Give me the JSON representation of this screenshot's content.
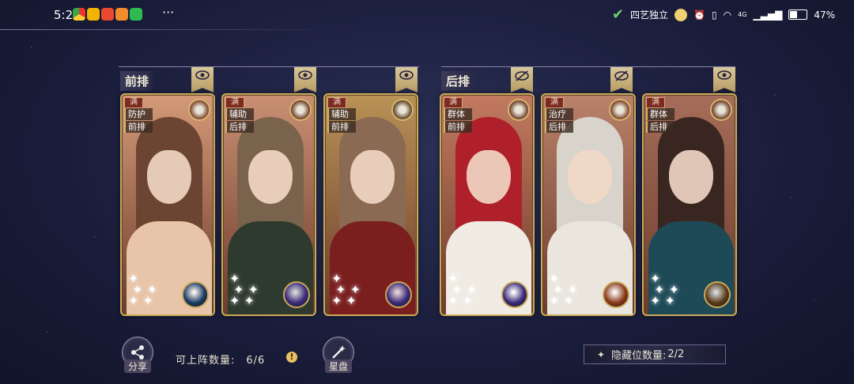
{
  "status_bar": {
    "time": "5:2",
    "more": "···",
    "mode_text": "四艺独立",
    "battery_percent": "47%",
    "network": "4G"
  },
  "sections": {
    "front_label": "前排",
    "back_label": "后排"
  },
  "cards": [
    {
      "mark": "满",
      "tags": [
        "防护",
        "前排"
      ],
      "element_icon": "white-fox-icon",
      "orb_icon": "blue-ring-orb-icon",
      "colors": {
        "bg": "#d49a78",
        "hair": "#6b4532",
        "body": "#e8c4a8",
        "elem": "#7a3f26",
        "orb": "#1b3a64"
      }
    },
    {
      "mark": "满",
      "tags": [
        "辅助",
        "后排"
      ],
      "element_icon": "white-bird-icon",
      "orb_icon": "purple-orb-icon",
      "colors": {
        "bg": "#c99073",
        "hair": "#7a634c",
        "body": "#2f3a2f",
        "elem": "#6b3a24",
        "orb": "#3a2a7a"
      }
    },
    {
      "mark": "满",
      "tags": [
        "辅助",
        "前排"
      ],
      "element_icon": "green-bird-icon",
      "orb_icon": "purple-orb-icon",
      "colors": {
        "bg": "#b89256",
        "hair": "#8a6a52",
        "body": "#7a1e1e",
        "elem": "#5a4020",
        "orb": "#3a2a7a"
      }
    },
    {
      "mark": "满",
      "tags": [
        "群体",
        "前排"
      ],
      "element_icon": "green-dragon-icon",
      "orb_icon": "purple-orb-icon",
      "colors": {
        "bg": "#c27a60",
        "hair": "#b0202a",
        "body": "#f0ece4",
        "elem": "#6b3a24",
        "orb": "#3a2a7a"
      }
    },
    {
      "mark": "满",
      "tags": [
        "治疗",
        "后排"
      ],
      "element_icon": "white-tiger-icon",
      "orb_icon": "gold-orb-icon",
      "colors": {
        "bg": "#b9826a",
        "hair": "#d8d4cc",
        "body": "#eae6de",
        "elem": "#7a3f26",
        "orb": "#8a3a1a"
      }
    },
    {
      "mark": "满",
      "tags": [
        "群体",
        "后排"
      ],
      "element_icon": "blue-bird-icon",
      "orb_icon": "gold-ring-orb-icon",
      "colors": {
        "bg": "#a66d5a",
        "hair": "#3a2620",
        "body": "#1e4a58",
        "elem": "#6b3a24",
        "orb": "#5a3a18"
      }
    }
  ],
  "bottom": {
    "share_label": "分享",
    "deploy_label": "可上阵数量:",
    "deploy_value": "6/6",
    "warn_symbol": "!",
    "star_label": "星盘",
    "hidden_label": "隐藏位数量:",
    "hidden_value": "2/2"
  }
}
